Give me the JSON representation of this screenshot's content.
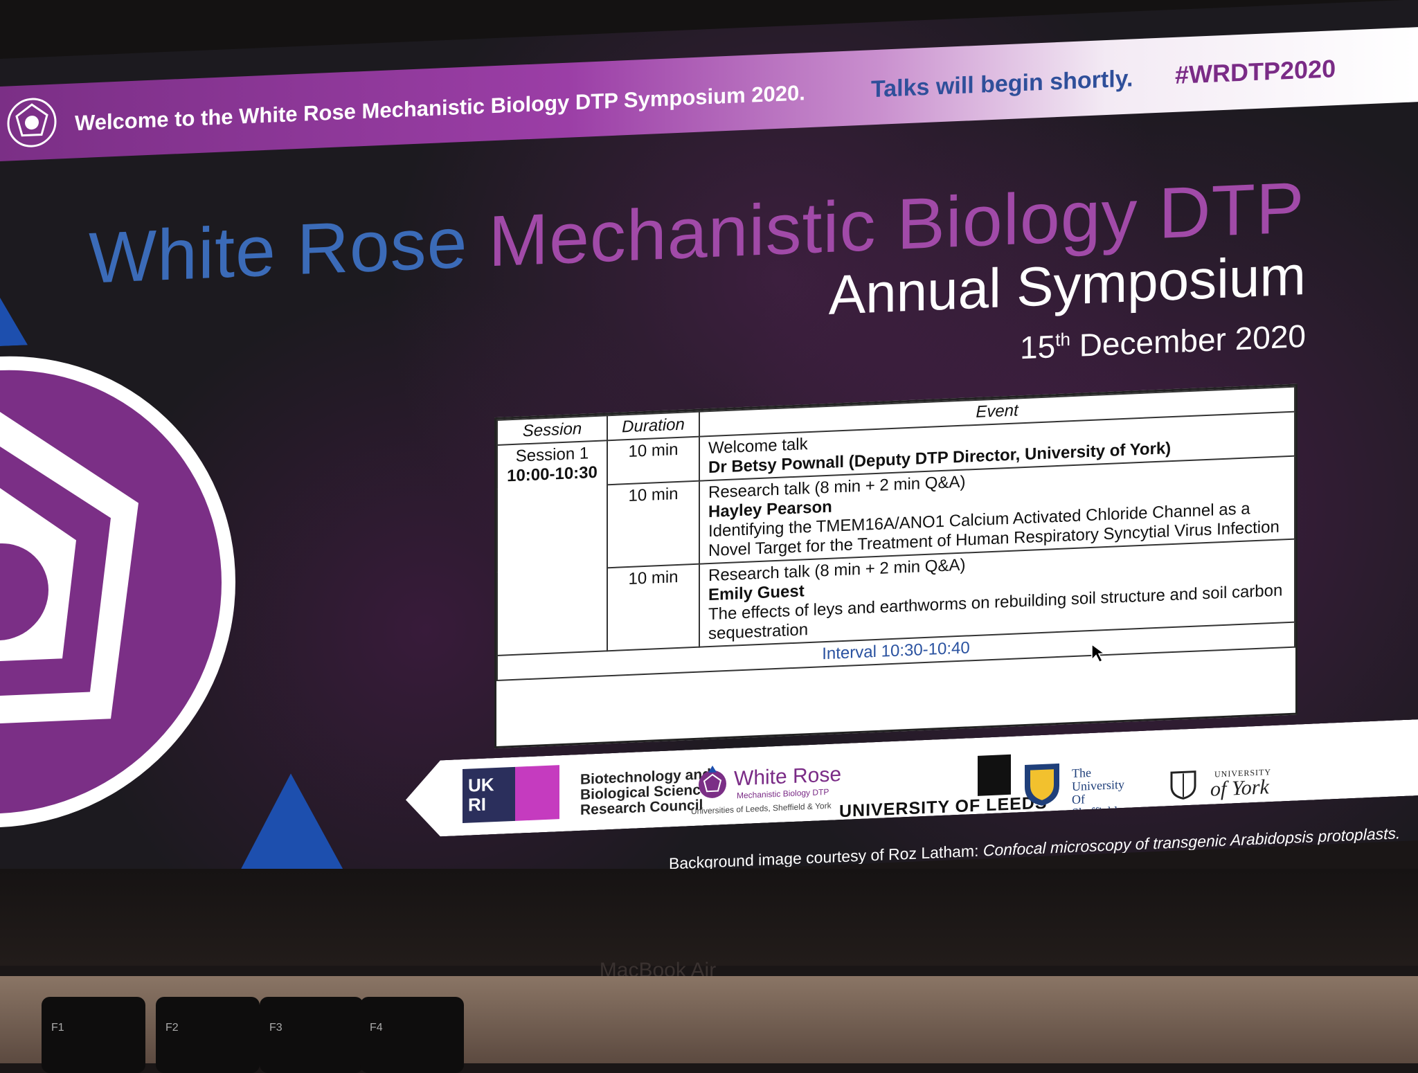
{
  "banner": {
    "welcome": "Welcome to the White Rose Mechanistic Biology DTP Symposium 2020.",
    "talks": "Talks will begin shortly.",
    "hashtag": "#WRDTP2020"
  },
  "title": {
    "white_rose": "White Rose",
    "mechanistic": "Mechanistic Biology DTP",
    "annual": "Annual Symposium",
    "date_day": "15",
    "date_suffix": "th",
    "date_rest": "December 2020"
  },
  "schedule": {
    "headers": {
      "session": "Session",
      "duration": "Duration",
      "event": "Event"
    },
    "session_name": "Session 1",
    "session_time": "10:00-10:30",
    "rows": [
      {
        "duration": "10 min",
        "type": "Welcome talk",
        "speaker": "Dr Betsy Pownall (Deputy DTP Director, University of York)",
        "title": ""
      },
      {
        "duration": "10 min",
        "type": "Research talk (8 min + 2 min Q&A)",
        "speaker": "Hayley Pearson",
        "title": "Identifying the TMEM16A/ANO1 Calcium Activated Chloride Channel as a Novel Target for the Treatment of Human Respiratory Syncytial Virus Infection"
      },
      {
        "duration": "10 min",
        "type": "Research talk (8 min + 2 min Q&A)",
        "speaker": "Emily Guest",
        "title": "The effects of leys and earthworms on rebuilding soil structure and soil carbon sequestration"
      }
    ],
    "interval": "Interval 10:30-10:40"
  },
  "logos": {
    "ukri": "UK RI",
    "bbsrc": [
      "Biotechnology and",
      "Biological Sciences",
      "Research Council"
    ],
    "white_rose_title": "White Rose",
    "white_rose_sub": "Mechanistic Biology DTP",
    "white_rose_unis": "Universities of Leeds, Sheffield & York",
    "leeds": "UNIVERSITY OF LEEDS",
    "sheffield": [
      "The",
      "University",
      "Of",
      "Sheffield."
    ],
    "york_small": "UNIVERSITY",
    "york_big": "of York"
  },
  "credit": {
    "prefix": "Background image courtesy of Roz Latham:",
    "italic": "Confocal microscopy of transgenic Arabidopsis protoplasts."
  },
  "laptop": {
    "brand": "MacBook Air",
    "keys": [
      "F1",
      "F2",
      "F3",
      "F4"
    ]
  },
  "colors": {
    "brand_purple": "#7b2f86",
    "brand_blue": "#3b6bb8",
    "talks_blue": "#2f4f9a"
  }
}
